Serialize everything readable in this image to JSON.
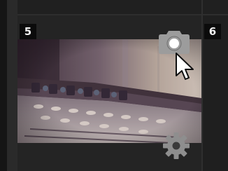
{
  "slots": [
    {
      "number": "5"
    },
    {
      "number": "6"
    }
  ],
  "thumbnail": {
    "subject": "mixing-console-photo"
  },
  "icons": {
    "camera": "camera-icon",
    "settings": "gear-icon",
    "cursor": "mouse-pointer"
  },
  "colors": {
    "background": "#1a1a1a",
    "slot_label_bg": "#0b0b0b",
    "slot_label_text": "#f2f2f2",
    "icon_gray": "#9a9a9a"
  }
}
